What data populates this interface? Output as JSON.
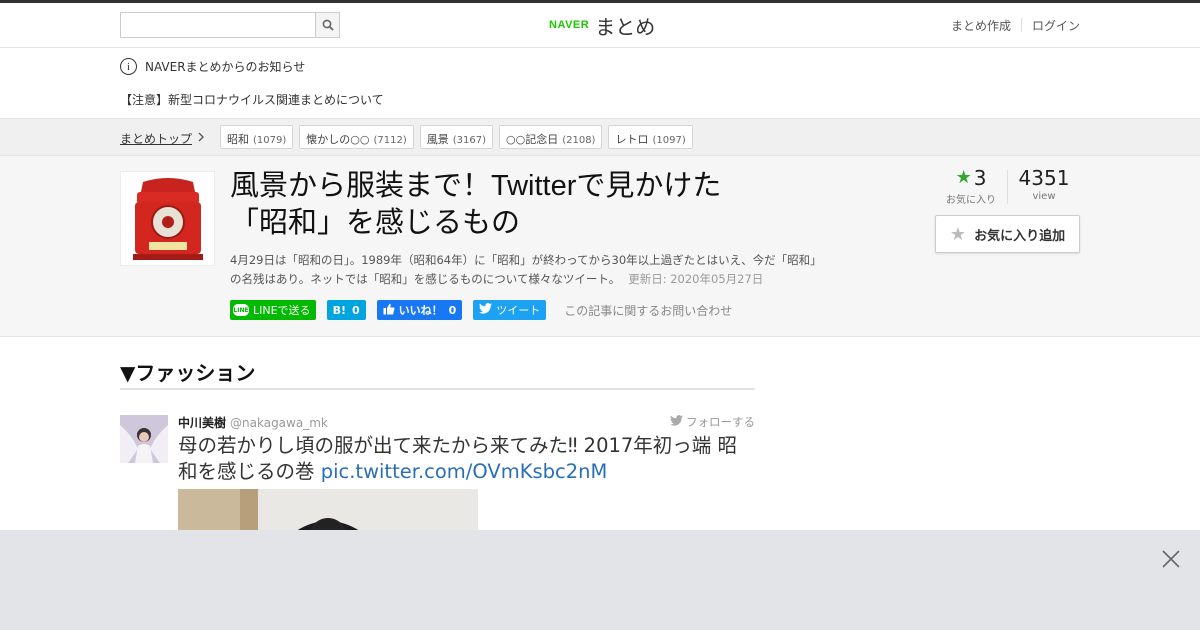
{
  "header": {
    "search": {
      "placeholder": "",
      "value": ""
    },
    "logo": {
      "naver": "NAVER",
      "matome": "まとめ"
    },
    "links": {
      "create": "まとめ作成",
      "login": "ログイン"
    }
  },
  "notice": {
    "title": "NAVERまとめからのお知らせ",
    "link": "【注意】新型コロナウイルス関連まとめについて"
  },
  "breadcrumb": {
    "top": "まとめトップ"
  },
  "tags": [
    {
      "name": "昭和",
      "count": "(1079)"
    },
    {
      "name": "懐かしの○○",
      "count": "(7112)"
    },
    {
      "name": "風景",
      "count": "(3167)"
    },
    {
      "name": "○○記念日",
      "count": "(2108)"
    },
    {
      "name": "レトロ",
      "count": "(1097)"
    }
  ],
  "article": {
    "title_line1": "風景から服装まで！Twitterで見かけた",
    "title_line2": "「昭和」を感じるもの",
    "description": "4月29日は「昭和の日」。1989年（昭和64年）に「昭和」が終わってから30年以上過ぎたとはいえ、今だ「昭和」の名残はあり。ネットでは「昭和」を感じるものについて様々なツイート。",
    "updated": "更新日: 2020年05月27日",
    "thumbnail_icon": "red-telephone-icon"
  },
  "share": {
    "line": "LINEで送る",
    "hatena_label": "B!",
    "hatena_count": "0",
    "facebook_label": "いいね！",
    "facebook_count": "0",
    "twitter": "ツイート",
    "contact": "この記事に関するお問い合わせ"
  },
  "stats": {
    "favorites": "3",
    "favorites_label": "お気に入り",
    "views": "4351",
    "views_label": "view",
    "fav_button": "お気に入り追加"
  },
  "section": {
    "title": "▼ファッション"
  },
  "tweet": {
    "name": "中川美樹",
    "handle": "@nakagawa_mk",
    "follow": "フォローする",
    "text": "母の若かりし頃の服が出て来たから来てみた‼ 2017年初っ端 昭和を感じるの巻 ",
    "link": "pic.twitter.com/OVmKsbc2nM"
  },
  "colors": {
    "naver_green": "#1ec800",
    "line_green": "#00b900",
    "hatena_blue": "#00a4de",
    "facebook_blue": "#1877f2",
    "twitter_blue": "#1da1f2",
    "star_green": "#33a72f",
    "link_blue": "#2a6fb5"
  }
}
